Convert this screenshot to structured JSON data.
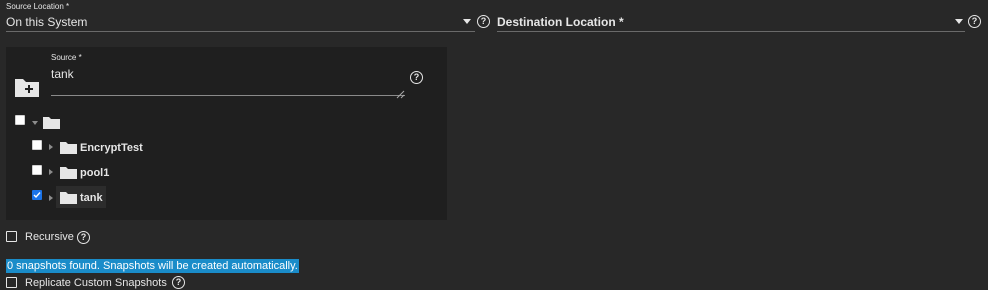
{
  "source_location": {
    "label": "Source Location *",
    "value": "On this System"
  },
  "destination_location": {
    "placeholder": "Destination Location *"
  },
  "source_panel": {
    "field_label": "Source *",
    "field_value": "tank",
    "tree": {
      "root": {
        "checked": false,
        "expanded": true
      },
      "items": [
        {
          "label": "EncryptTest",
          "checked": false,
          "expanded": false
        },
        {
          "label": "pool1",
          "checked": false,
          "expanded": false
        },
        {
          "label": "tank",
          "checked": true,
          "expanded": false,
          "selected": true
        }
      ]
    }
  },
  "recursive": {
    "label": "Recursive",
    "checked": false
  },
  "snapshot_info": "0 snapshots found. Snapshots will be created automatically.",
  "replicate_custom": {
    "label": "Replicate Custom Snapshots",
    "checked": false
  },
  "colors": {
    "background": "#282828",
    "panel": "#1f1f1f",
    "highlight": "#1a8cc9",
    "checkbox_checked": "#1a73e8"
  },
  "icons": [
    "chevron-down-icon",
    "help-icon",
    "folder-add-icon",
    "folder-icon",
    "expand-arrow-icon"
  ]
}
